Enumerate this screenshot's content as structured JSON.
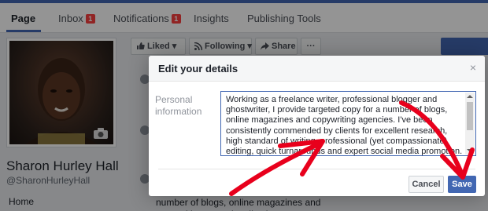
{
  "tabs": [
    {
      "label": "Page",
      "badge": ""
    },
    {
      "label": "Inbox",
      "badge": "1"
    },
    {
      "label": "Notifications",
      "badge": "1"
    },
    {
      "label": "Insights",
      "badge": ""
    },
    {
      "label": "Publishing Tools",
      "badge": ""
    }
  ],
  "profile": {
    "name": "Sharon Hurley Hall",
    "handle": "@SharonHurleyHall",
    "nav_home": "Home"
  },
  "actions": {
    "liked": "Liked",
    "following": "Following",
    "share": "Share",
    "more": "···"
  },
  "background_about": "ghostwriter, I provide targeted copy for a number of blogs, online magazines and copywriting agencies. I've been",
  "dialog": {
    "title": "Edit your details",
    "close": "×",
    "field_label": "Personal information",
    "field_value": "Working as a freelance writer, professional blogger and ghostwriter, I provide targeted copy for a number of blogs, online magazines and copywriting agencies. I've been consistently commended by clients for excellent research, high standard of writing, professional (yet compassionate) editing, quick turnarounds and expert social media promotion. Currently writing for https://optinmonster.com",
    "cancel": "Cancel",
    "save": "Save"
  },
  "colors": {
    "brand": "#4267b2",
    "badge": "#fa3e3e",
    "annotation_arrow": "#e8001c"
  }
}
